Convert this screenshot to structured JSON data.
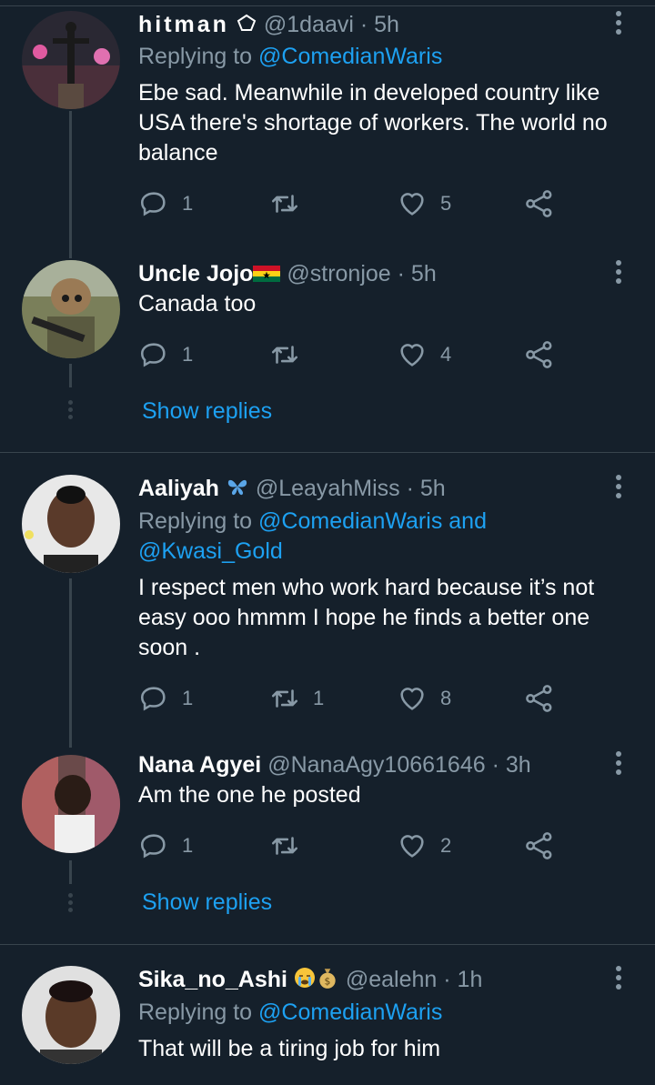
{
  "tweets": [
    {
      "name": "hitman",
      "handle": "@1daavi",
      "time": "· 5h",
      "reply_prefix": "Replying to",
      "reply_to_line1": "@ComedianWaris",
      "reply_to_line2": "",
      "text": "Ebe sad. Meanwhile in developed country like USA there's shortage of workers. The world no balance",
      "replies": "1",
      "retweets": "",
      "likes": "5"
    },
    {
      "name": "Uncle Jojo",
      "handle": "@stronjoe",
      "time": "· 5h",
      "text": "Canada too",
      "replies": "1",
      "retweets": "",
      "likes": "4",
      "show_replies": "Show replies"
    },
    {
      "name": "Aaliyah",
      "handle": "@LeayahMiss",
      "time": "· 5h",
      "reply_prefix": "Replying to",
      "reply_to_line1": "@ComedianWaris and",
      "reply_to_line2": "@Kwasi_Gold",
      "text": "I respect men who work hard because it’s not easy ooo hmmm I hope he finds a better one soon .",
      "replies": "1",
      "retweets": "1",
      "likes": "8"
    },
    {
      "name": "Nana Agyei",
      "handle": "@NanaAgy10661646",
      "time": "· 3h",
      "text": "Am the one he posted",
      "replies": "1",
      "retweets": "",
      "likes": "2",
      "show_replies": "Show replies"
    },
    {
      "name": "Sika_no_Ashi",
      "handle": "@ealehn",
      "time": "· 1h",
      "reply_prefix": "Replying to",
      "reply_to_line1": "@ComedianWaris",
      "text": "That will be a tiring job for him"
    }
  ],
  "icons": {
    "reply": "reply-icon",
    "retweet": "retweet-icon",
    "like": "heart-icon",
    "share": "share-icon",
    "more": "more-vertical-icon"
  },
  "colors": {
    "background": "#15202b",
    "link": "#1da1f2",
    "muted": "#8899a6",
    "divider": "#38444d"
  }
}
